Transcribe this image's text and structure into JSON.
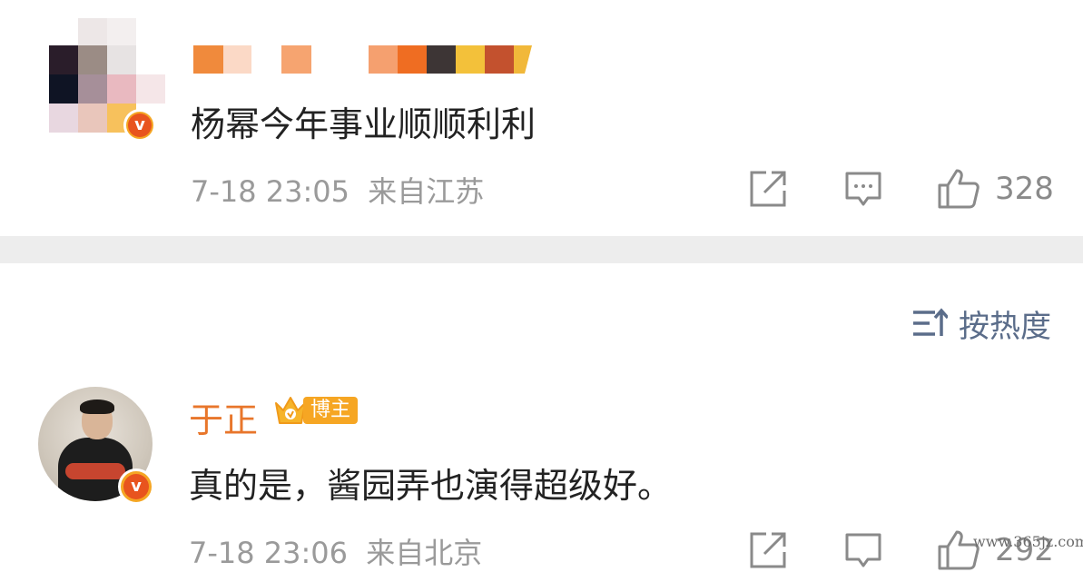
{
  "comments": [
    {
      "text": "杨幂今年事业顺顺利利",
      "timestamp": "7-18 23:05",
      "location": "来自江苏",
      "likes": "328",
      "username_visible": false
    },
    {
      "username": "于正",
      "badge": "博主",
      "text": "真的是，酱园弄也演得超级好。",
      "timestamp": "7-18 23:06",
      "location": "来自北京",
      "likes": "292"
    }
  ],
  "sort": {
    "label": "按热度"
  },
  "icons": {
    "share": "share-icon",
    "comment": "comment-icon",
    "like": "thumbs-up-icon",
    "sort": "sort-icon",
    "verified": "verified-v-badge-icon",
    "crown": "crown-icon"
  },
  "colors": {
    "username": "#e8762b",
    "meta": "#9a9a9a",
    "sort": "#5b6d8a",
    "divider": "#ededed",
    "verified": "#f5a623"
  },
  "watermark": "www.365jz.com"
}
